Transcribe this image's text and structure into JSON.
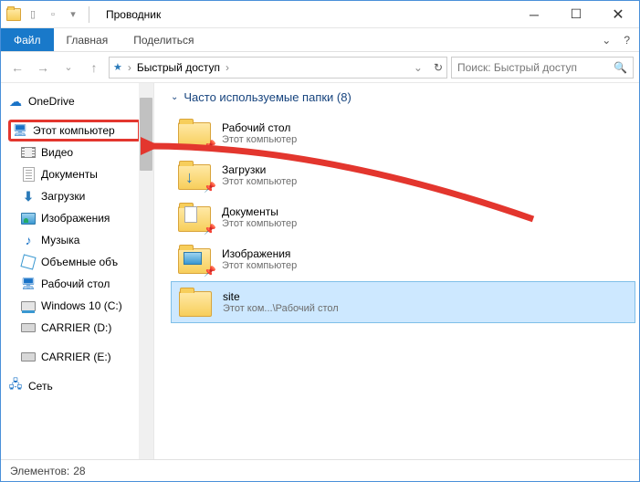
{
  "title": "Проводник",
  "ribbon": {
    "file": "Файл",
    "home": "Главная",
    "share": "Поделиться",
    "help_icon": "?"
  },
  "address": {
    "location": "Быстрый доступ",
    "crumb_sep": "›"
  },
  "search": {
    "placeholder": "Поиск: Быстрый доступ"
  },
  "nav": {
    "onedrive": "OneDrive",
    "this_pc": "Этот компьютер",
    "videos": "Видео",
    "documents": "Документы",
    "downloads": "Загрузки",
    "pictures": "Изображения",
    "music": "Музыка",
    "objects3d": "Объемные объ",
    "desktop": "Рабочий стол",
    "drive_c": "Windows 10 (C:)",
    "drive_carrier1": "CARRIER (D:)",
    "drive_carrier2": "CARRIER (E:)",
    "network": "Сеть"
  },
  "content": {
    "group_title": "Часто используемые папки (8)",
    "items": [
      {
        "name": "Рабочий стол",
        "sub": "Этот компьютер",
        "overlay": "none"
      },
      {
        "name": "Загрузки",
        "sub": "Этот компьютер",
        "overlay": "down"
      },
      {
        "name": "Документы",
        "sub": "Этот компьютер",
        "overlay": "doc"
      },
      {
        "name": "Изображения",
        "sub": "Этот компьютер",
        "overlay": "pic"
      },
      {
        "name": "site",
        "sub": "Этот ком...\\Рабочий стол",
        "overlay": "none",
        "selected": true,
        "pin": false
      }
    ]
  },
  "status": {
    "label": "Элементов:",
    "count": "28"
  },
  "colors": {
    "accent": "#1979ca",
    "highlight_border": "#e3362e"
  }
}
